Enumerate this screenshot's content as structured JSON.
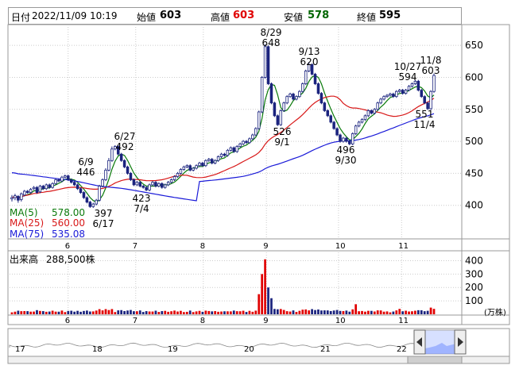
{
  "header": {
    "date_label": "日付",
    "datetime": "2022/11/09 10:19",
    "open_label": "始値",
    "open": "603",
    "high_label": "高値",
    "high": "603",
    "low_label": "安値",
    "low": "578",
    "close_label": "終値",
    "close": "595"
  },
  "moving_averages": [
    {
      "label": "MA(5)",
      "value": "578.00",
      "color": "#0a7a0a"
    },
    {
      "label": "MA(25)",
      "value": "560.00",
      "color": "#d81818"
    },
    {
      "label": "MA(75)",
      "value": "535.08",
      "color": "#1a1ad8"
    }
  ],
  "volume_panel": {
    "label": "出来高",
    "value": "288,500株",
    "unit": "(万株)"
  },
  "chart_data": {
    "type": "line",
    "candle_color_up": "#ffffff",
    "candle_color_down": "#1a237e",
    "ylim": [
      350,
      680
    ],
    "y_ticks": [
      400,
      450,
      500,
      550,
      600,
      650
    ],
    "x_ticks": [
      "6",
      "7",
      "8",
      "9",
      "10",
      "11"
    ],
    "series": [
      {
        "type": "candlestick",
        "x": [
          0,
          2,
          4,
          6,
          8,
          10,
          12,
          14,
          16,
          18,
          20,
          22,
          24,
          26,
          28,
          30,
          32,
          34,
          36,
          38,
          40,
          42,
          44,
          46,
          48,
          50,
          52,
          54,
          56,
          58,
          60,
          62,
          64,
          66,
          68,
          70,
          72,
          74,
          76,
          78,
          80,
          82,
          84,
          86,
          88,
          90,
          92,
          94,
          96,
          98,
          100,
          102,
          104,
          106,
          108,
          110,
          112,
          114,
          116,
          118,
          120,
          122,
          124,
          126,
          128,
          130,
          132,
          134,
          136,
          138,
          140,
          142,
          144,
          146,
          148,
          150,
          152,
          154,
          156,
          158,
          160,
          162,
          164,
          166,
          168,
          170,
          172,
          174,
          176,
          178,
          180,
          182,
          184,
          186,
          188,
          190,
          192,
          194,
          196,
          198,
          200,
          202,
          204,
          206,
          208,
          210,
          212,
          214,
          216,
          218,
          220,
          222,
          224,
          226,
          228,
          230,
          232,
          234,
          236,
          238,
          240,
          242,
          244,
          246,
          248,
          250,
          252,
          254,
          256,
          258,
          260,
          262,
          264,
          266,
          268,
          270
        ],
        "close": [
          412,
          415,
          408,
          418,
          422,
          420,
          425,
          428,
          420,
          430,
          426,
          432,
          428,
          434,
          440,
          438,
          444,
          446,
          440,
          436,
          432,
          426,
          420,
          412,
          405,
          398,
          402,
          408,
          430,
          440,
          455,
          470,
          488,
          492,
          480,
          470,
          460,
          450,
          440,
          432,
          436,
          430,
          428,
          424,
          432,
          436,
          430,
          434,
          428,
          432,
          436,
          440,
          445,
          450,
          456,
          460,
          462,
          455,
          458,
          462,
          466,
          462,
          470,
          472,
          466,
          470,
          476,
          480,
          478,
          486,
          490,
          484,
          492,
          496,
          500,
          498,
          504,
          510,
          520,
          546,
          600,
          648,
          590,
          560,
          540,
          526,
          548,
          560,
          570,
          574,
          566,
          570,
          578,
          590,
          610,
          620,
          605,
          590,
          575,
          560,
          548,
          540,
          530,
          520,
          510,
          500,
          505,
          500,
          496,
          512,
          524,
          530,
          534,
          540,
          548,
          544,
          550,
          560,
          566,
          570,
          572,
          574,
          570,
          578,
          580,
          575,
          580,
          586,
          590,
          594,
          580,
          570,
          560,
          551,
          578,
          603
        ],
        "open": [
          410,
          412,
          414,
          409,
          416,
          422,
          420,
          426,
          428,
          421,
          430,
          426,
          432,
          428,
          434,
          440,
          438,
          444,
          446,
          440,
          436,
          432,
          426,
          420,
          412,
          405,
          398,
          402,
          408,
          430,
          440,
          455,
          470,
          488,
          492,
          480,
          470,
          460,
          450,
          440,
          432,
          436,
          430,
          428,
          424,
          432,
          436,
          430,
          434,
          428,
          432,
          436,
          440,
          445,
          450,
          456,
          460,
          462,
          455,
          458,
          462,
          466,
          462,
          470,
          472,
          466,
          470,
          476,
          480,
          478,
          486,
          490,
          484,
          492,
          496,
          500,
          498,
          504,
          510,
          520,
          546,
          600,
          648,
          590,
          560,
          540,
          526,
          548,
          560,
          570,
          574,
          566,
          570,
          578,
          590,
          610,
          620,
          605,
          590,
          575,
          560,
          548,
          540,
          530,
          520,
          510,
          500,
          505,
          500,
          496,
          512,
          524,
          530,
          534,
          540,
          548,
          544,
          550,
          560,
          566,
          570,
          572,
          574,
          570,
          578,
          580,
          575,
          580,
          586,
          590,
          594,
          580,
          570,
          560,
          551,
          578
        ],
        "high": [
          416,
          418,
          416,
          420,
          424,
          424,
          427,
          430,
          430,
          432,
          432,
          434,
          434,
          436,
          442,
          442,
          446,
          448,
          448,
          442,
          438,
          434,
          428,
          422,
          414,
          407,
          404,
          410,
          432,
          442,
          458,
          474,
          492,
          494,
          494,
          482,
          472,
          462,
          452,
          442,
          438,
          438,
          432,
          430,
          434,
          438,
          438,
          436,
          436,
          434,
          438,
          442,
          447,
          452,
          458,
          462,
          464,
          464,
          460,
          464,
          468,
          468,
          472,
          474,
          474,
          472,
          478,
          482,
          482,
          488,
          492,
          492,
          494,
          498,
          502,
          502,
          506,
          512,
          522,
          548,
          602,
          652,
          650,
          592,
          562,
          542,
          550,
          562,
          572,
          576,
          576,
          572,
          580,
          592,
          612,
          624,
          622,
          607,
          592,
          577,
          562,
          550,
          542,
          532,
          522,
          512,
          507,
          507,
          502,
          514,
          526,
          532,
          536,
          542,
          550,
          550,
          552,
          562,
          568,
          572,
          574,
          576,
          576,
          580,
          582,
          582,
          582,
          588,
          592,
          596,
          596,
          582,
          572,
          562,
          580,
          606
        ],
        "low": [
          406,
          408,
          404,
          406,
          414,
          418,
          418,
          424,
          418,
          419,
          424,
          424,
          426,
          426,
          432,
          436,
          436,
          442,
          438,
          434,
          430,
          424,
          418,
          410,
          403,
          396,
          396,
          400,
          406,
          428,
          438,
          453,
          468,
          486,
          478,
          468,
          458,
          448,
          438,
          430,
          430,
          428,
          426,
          422,
          422,
          430,
          428,
          428,
          426,
          426,
          430,
          434,
          438,
          443,
          448,
          454,
          458,
          453,
          453,
          456,
          460,
          460,
          460,
          468,
          464,
          464,
          468,
          474,
          476,
          476,
          484,
          482,
          482,
          490,
          494,
          496,
          496,
          502,
          508,
          518,
          544,
          598,
          588,
          558,
          538,
          524,
          524,
          546,
          558,
          568,
          564,
          564,
          568,
          576,
          588,
          608,
          603,
          588,
          573,
          558,
          546,
          538,
          528,
          518,
          508,
          498,
          498,
          498,
          494,
          494,
          510,
          522,
          528,
          532,
          538,
          542,
          542,
          548,
          558,
          564,
          568,
          570,
          568,
          568,
          576,
          573,
          573,
          578,
          584,
          588,
          578,
          568,
          558,
          549,
          549,
          576
        ]
      },
      {
        "name": "MA(5)",
        "type": "line",
        "values": []
      },
      {
        "name": "MA(25)",
        "type": "line",
        "values": []
      },
      {
        "name": "MA(75)",
        "type": "line",
        "values": []
      }
    ],
    "annotations": [
      {
        "date": "6/9",
        "price": "446"
      },
      {
        "date": "6/17",
        "price": "397"
      },
      {
        "date": "6/27",
        "price": "492"
      },
      {
        "date": "7/4",
        "price": "423"
      },
      {
        "date": "8/29",
        "price": "648"
      },
      {
        "date": "9/1",
        "price": "526"
      },
      {
        "date": "9/13",
        "price": "620"
      },
      {
        "date": "9/30",
        "price": "496"
      },
      {
        "date": "10/27",
        "price": "594"
      },
      {
        "date": "11/8",
        "price": "603"
      },
      {
        "date": "11/4",
        "price": "551"
      }
    ],
    "volume": {
      "ylim": [
        0,
        450
      ],
      "y_ticks": [
        100,
        200,
        300,
        400
      ],
      "x_ticks": [
        "6",
        "7",
        "8",
        "9",
        "10",
        "11"
      ]
    },
    "overview": {
      "x_ticks": [
        "17",
        "18",
        "19",
        "20",
        "21",
        "22"
      ]
    }
  }
}
